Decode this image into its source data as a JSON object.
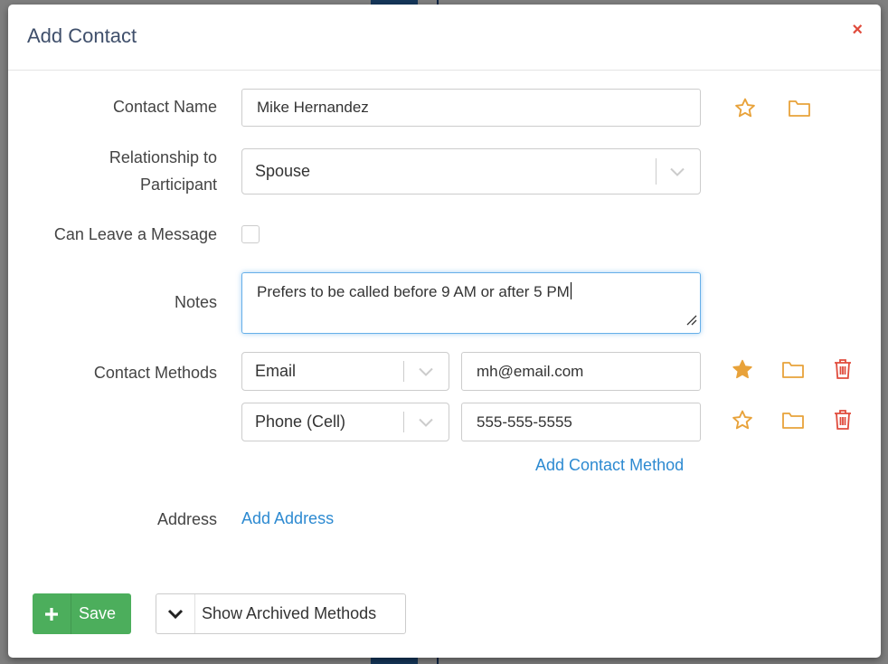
{
  "modal": {
    "title": "Add Contact",
    "close_symbol": "×"
  },
  "fields": {
    "contact_name": {
      "label": "Contact Name",
      "value": "Mike Hernandez"
    },
    "relationship": {
      "label_line1": "Relationship to",
      "label_line2": "Participant",
      "value": "Spouse"
    },
    "can_leave_message": {
      "label": "Can Leave a Message",
      "checked": false
    },
    "notes": {
      "label": "Notes",
      "value": "Prefers to be called before 9 AM or after 5 PM"
    },
    "contact_methods": {
      "label": "Contact Methods",
      "items": [
        {
          "type": "Email",
          "value": "mh@email.com",
          "primary": true
        },
        {
          "type": "Phone (Cell)",
          "value": "555-555-5555",
          "primary": false
        }
      ],
      "add_label": "Add Contact Method"
    },
    "address": {
      "label": "Address",
      "add_label": "Add Address"
    }
  },
  "footer": {
    "save_label": "Save",
    "show_archived_label": "Show Archived Methods"
  },
  "colors": {
    "accent_gold": "#e8a23a",
    "danger": "#e04b3c",
    "success": "#4cae5c",
    "link": "#2d8ad1"
  },
  "icons": {
    "favorite": "star-icon",
    "folder": "folder-icon",
    "delete": "trash-icon",
    "close": "close-icon",
    "save": "plus-icon",
    "expand": "chevron-down-icon"
  }
}
